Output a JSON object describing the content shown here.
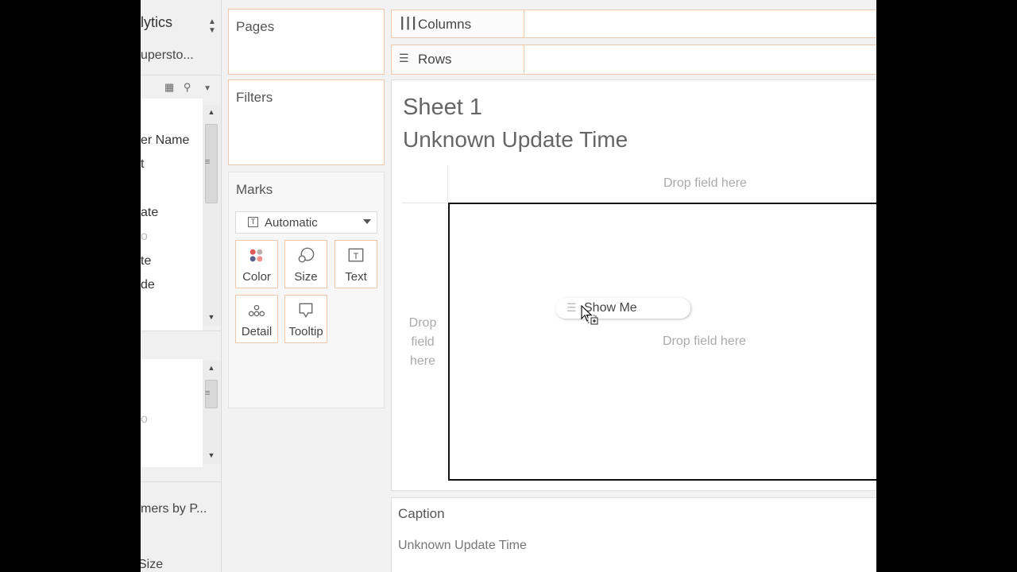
{
  "data_pane": {
    "tab_label": "lytics",
    "datasource": "upersto...",
    "dimensions": [
      "er Name",
      "t",
      "ate",
      "o",
      "te",
      "de"
    ],
    "measures": [
      "o"
    ],
    "sets_item": "mers by P...",
    "parameters_item": "Size"
  },
  "shelves": {
    "pages": "Pages",
    "filters": "Filters",
    "columns": "Columns",
    "rows": "Rows"
  },
  "marks": {
    "title": "Marks",
    "mark_type": "Automatic",
    "buttons": {
      "color": "Color",
      "size": "Size",
      "text": "Text",
      "detail": "Detail",
      "tooltip": "Tooltip"
    }
  },
  "sheet": {
    "title": "Sheet 1",
    "subtitle": "Unknown Update Time",
    "drop_top": "Drop field here",
    "drop_left": [
      "Drop",
      "field",
      "here"
    ],
    "drop_center": "Drop field here",
    "show_me": "Show Me"
  },
  "caption": {
    "title": "Caption",
    "text": "Unknown Update Time"
  },
  "colors": {
    "shelf_border": "#f0c7a8",
    "background": "#f2f2f2"
  }
}
